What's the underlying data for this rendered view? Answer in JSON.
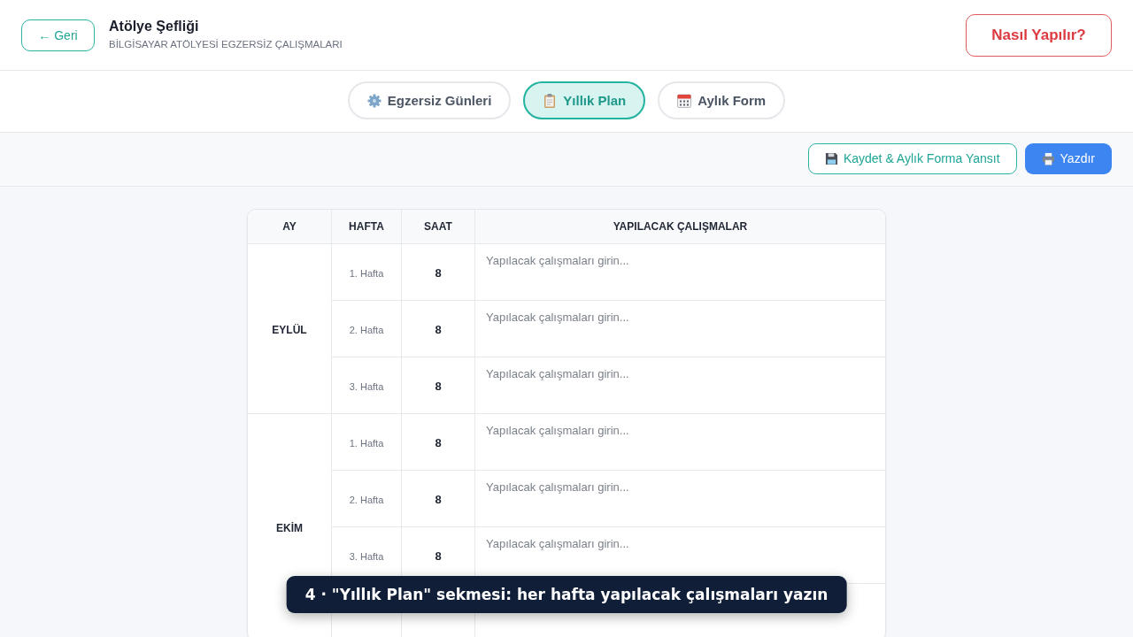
{
  "header": {
    "back_button": "← Geri",
    "title": "Atölye Şefliği",
    "subtitle": "BİLGİSAYAR ATÖLYESİ EGZERSİZ ÇALIŞMALARI",
    "help_button": "Nasıl Yapılır?"
  },
  "tabs": [
    {
      "label": "Egzersiz Günleri",
      "selected": false
    },
    {
      "label": "Yıllık Plan",
      "selected": true
    },
    {
      "label": "Aylık Form",
      "selected": false
    }
  ],
  "toolbar": {
    "buttons": [
      {
        "label": "Kaydet & Aylık Forma Yansıt",
        "kind": "save"
      },
      {
        "label": "Yazdır",
        "kind": "print"
      }
    ]
  },
  "table": {
    "columns": [
      "AY",
      "HAFTA",
      "SAAT",
      "YAPILACAK ÇALIŞMALAR"
    ],
    "months": [
      {
        "name": "EYLÜL",
        "weeks": [
          {
            "kind": "week",
            "label": "1. Hafta",
            "hours": "8",
            "placeholder": "Yapılacak çalışmaları girin..."
          },
          {
            "kind": "week",
            "label": "2. Hafta",
            "hours": "8",
            "placeholder": "Yapılacak çalışmaları girin..."
          },
          {
            "kind": "week",
            "label": "3. Hafta",
            "hours": "8",
            "placeholder": "Yapılacak çalışmaları girin..."
          }
        ]
      },
      {
        "name": "EKİM",
        "weeks": [
          {
            "kind": "week",
            "label": "1. Hafta",
            "hours": "8",
            "placeholder": "Yapılacak çalışmaları girin..."
          },
          {
            "kind": "week",
            "label": "2. Hafta",
            "hours": "8",
            "placeholder": "Yapılacak çalışmaları girin..."
          },
          {
            "kind": "week",
            "label": "3. Hafta",
            "hours": "8",
            "placeholder": "Yapılacak çalışmaları girin..."
          },
          {
            "kind": "blank"
          }
        ]
      }
    ]
  },
  "caption": "4 · \"Yıllık Plan\" sekmesi: her hafta yapılacak çalışmaları yazın"
}
